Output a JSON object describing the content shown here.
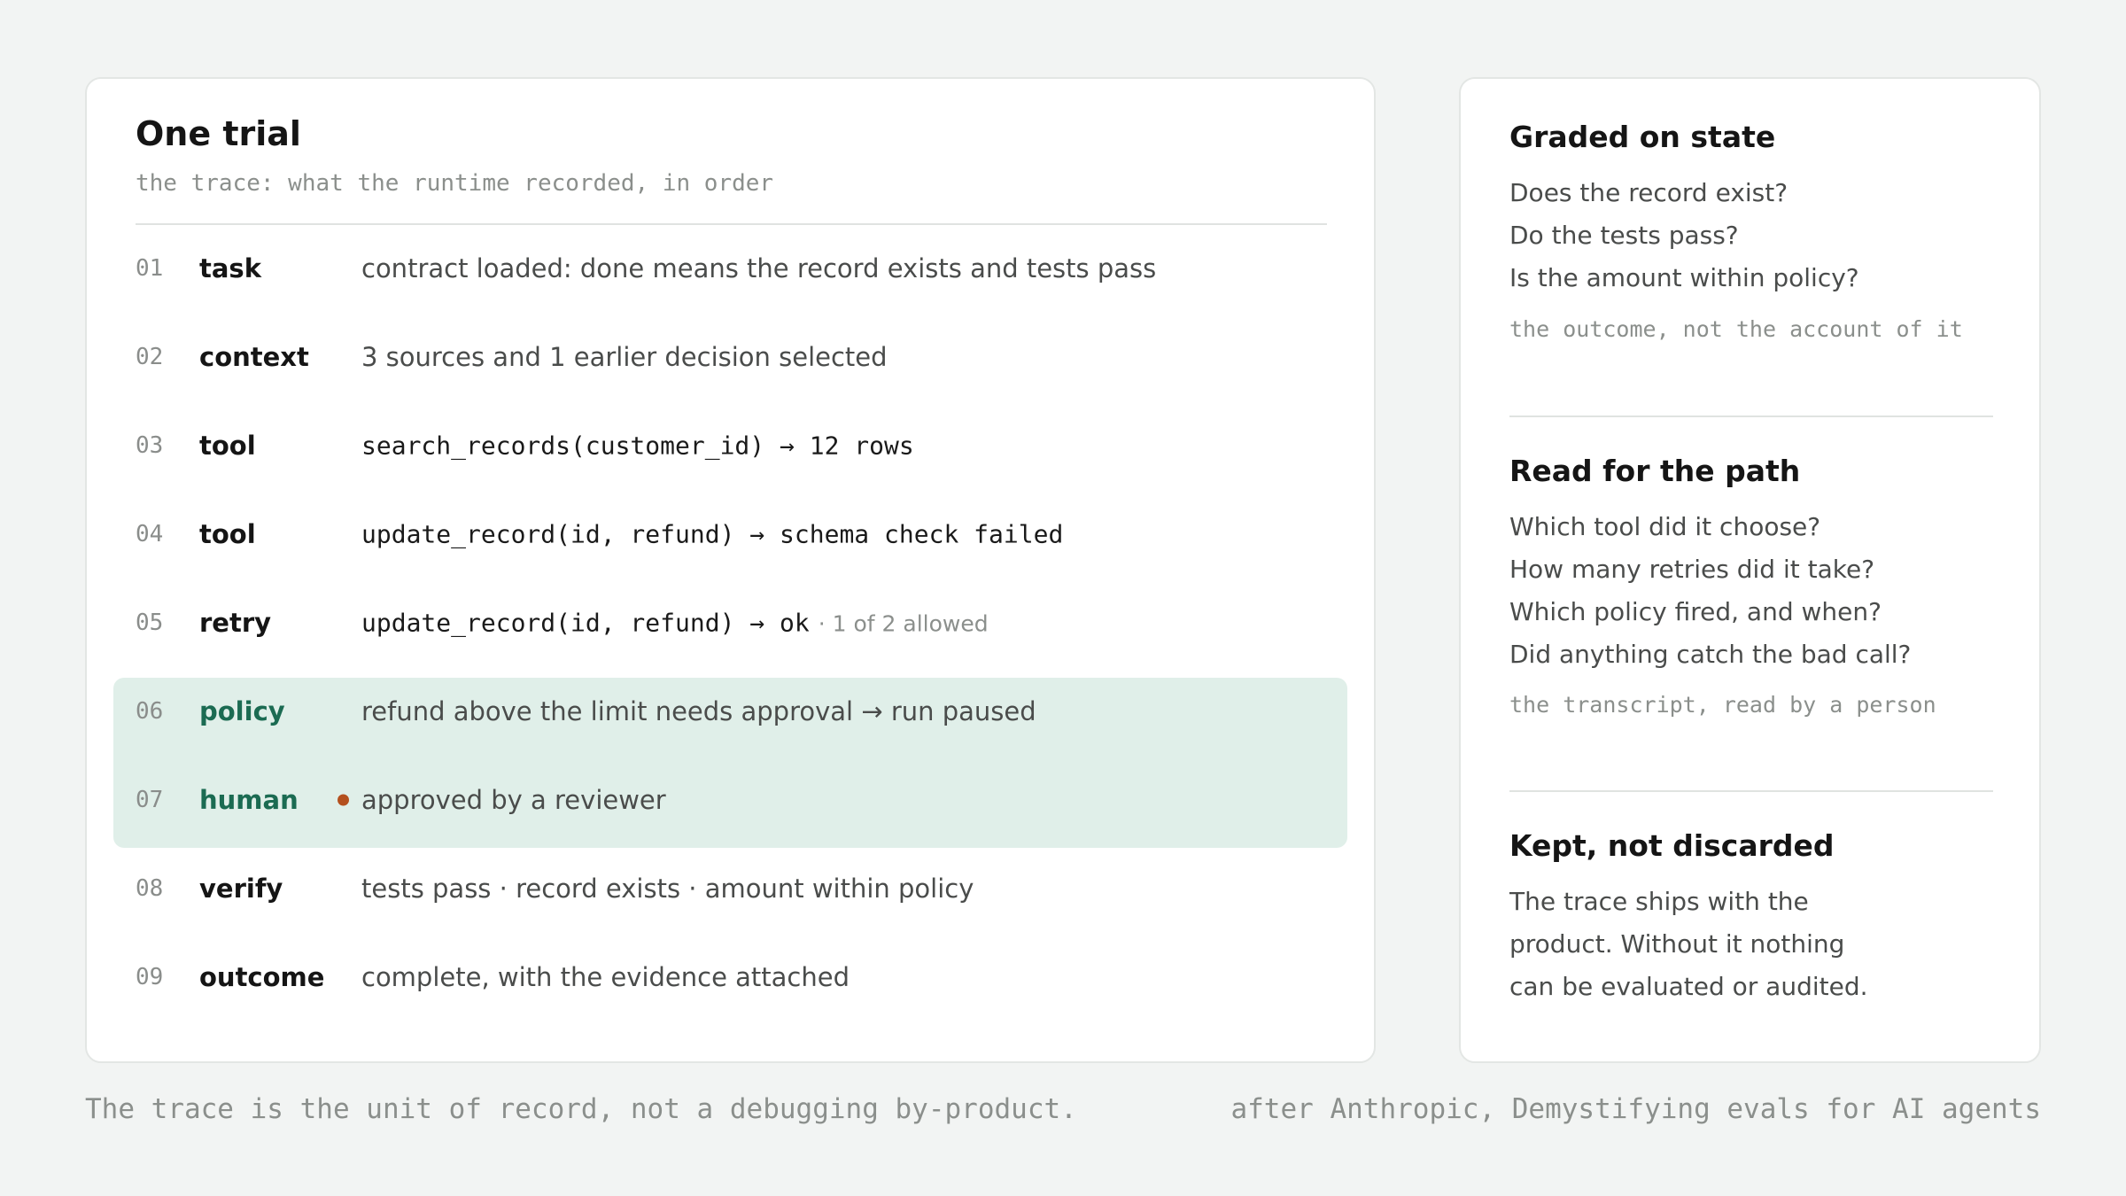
{
  "trace": {
    "title": "One trial",
    "subtitle": "the trace: what the runtime recorded, in order",
    "rows": [
      {
        "num": "01",
        "label": "task",
        "desc": "contract loaded: done means the record exists and tests pass"
      },
      {
        "num": "02",
        "label": "context",
        "desc": "3 sources and 1 earlier decision selected"
      },
      {
        "num": "03",
        "label": "tool",
        "desc": "search_records(customer_id) → 12 rows"
      },
      {
        "num": "04",
        "label": "tool",
        "desc": "update_record(id, refund) → schema check failed"
      },
      {
        "num": "05",
        "label": "retry",
        "desc": "update_record(id, refund) → ok",
        "note": "· 1 of 2 allowed"
      },
      {
        "num": "06",
        "label": "policy",
        "desc": "refund above the limit needs approval → run paused"
      },
      {
        "num": "07",
        "label": "human",
        "desc": "approved by a reviewer"
      },
      {
        "num": "08",
        "label": "verify",
        "desc": "tests pass · record exists · amount within policy"
      },
      {
        "num": "09",
        "label": "outcome",
        "desc": "complete, with the evidence attached"
      }
    ]
  },
  "notes": {
    "graded": {
      "title": "Graded on state",
      "lines": [
        "Does the record exist?",
        "Do the tests pass?",
        "Is the amount within policy?"
      ],
      "note": "the outcome, not the account of it"
    },
    "path": {
      "title": "Read for the path",
      "lines": [
        "Which tool did it choose?",
        "How many retries did it take?",
        "Which policy fired, and when?",
        "Did anything catch the bad call?"
      ],
      "note": "the transcript, read by a person"
    },
    "kept": {
      "title": "Kept, not discarded",
      "lines": [
        "The trace ships with the",
        "product. Without it nothing",
        "can be evaluated or audited."
      ]
    }
  },
  "footer": {
    "left": "The trace is the unit of record, not a debugging by-product.",
    "right": "after Anthropic, Demystifying evals for AI agents"
  },
  "colors": {
    "background": "#f2f4f3",
    "highlight": "#e0efe9",
    "highlight_label": "#1b6b52",
    "human_marker": "#b4501e"
  },
  "highlighted_steps": [
    "06",
    "07"
  ]
}
